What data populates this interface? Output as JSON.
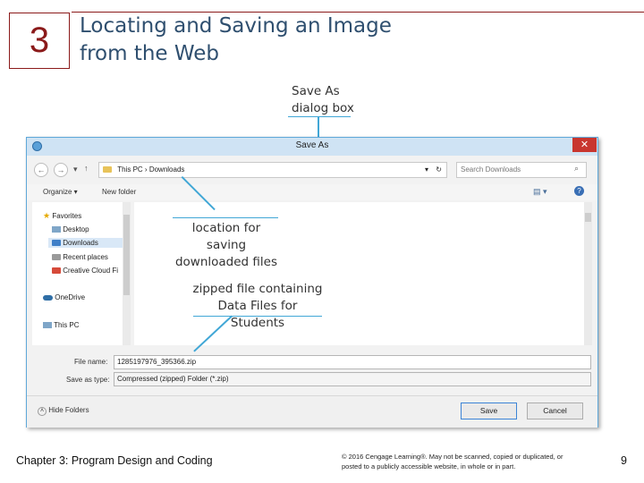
{
  "slide": {
    "chapter_number": "3",
    "title_line1": "Locating and Saving an Image",
    "title_line2": "from the Web",
    "footer_chapter": "Chapter 3: Program Design and Coding",
    "footer_copyright": "© 2016 Cengage Learning®. May not be scanned, copied or duplicated, or posted to a publicly accessible website, in whole or in part.",
    "page_number": "9"
  },
  "callouts": {
    "save_as_line1": "Save As",
    "save_as_line2": "dialog box",
    "location_line1": "location for saving",
    "location_line2": "downloaded files",
    "zipped_line1": "zipped file containing",
    "zipped_line2": "Data Files for Students"
  },
  "dialog": {
    "title": "Save As",
    "close_glyph": "✕",
    "breadcrumb": [
      "This PC",
      "Downloads"
    ],
    "search_placeholder": "Search Downloads",
    "toolbar": {
      "organize": "Organize ▾",
      "new_folder": "New folder"
    },
    "nav": {
      "favorites": "Favorites",
      "items": [
        "Desktop",
        "Downloads",
        "Recent places",
        "Creative Cloud Fi"
      ],
      "onedrive": "OneDrive",
      "this_pc": "This PC"
    },
    "file_name_label": "File name:",
    "file_name_value": "1285197976_395366.zip",
    "save_type_label": "Save as type:",
    "save_type_value": "Compressed (zipped) Folder (*.zip)",
    "hide_folders": "Hide Folders",
    "save_button": "Save",
    "cancel_button": "Cancel"
  },
  "colors": {
    "accent": "#41a7d6",
    "title_text": "#2f4f6f",
    "chapter_red": "#8b1a1a",
    "close_red": "#c8362f"
  }
}
